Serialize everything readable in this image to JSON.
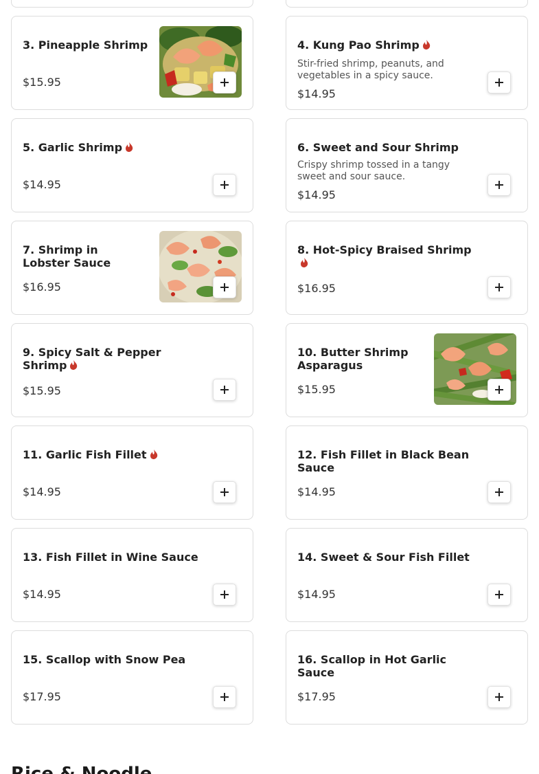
{
  "menu": {
    "items": [
      {
        "name": "3. Pineapple Shrimp",
        "price": "$15.95",
        "spicy": false,
        "image": "food-photo-pineapple-shrimp"
      },
      {
        "name": "4. Kung Pao Shrimp",
        "price": "$14.95",
        "spicy": true,
        "description": "Stir-fried shrimp, peanuts, and vegetables in a spicy sauce."
      },
      {
        "name": "5. Garlic Shrimp",
        "price": "$14.95",
        "spicy": true
      },
      {
        "name": "6. Sweet and Sour Shrimp",
        "price": "$14.95",
        "spicy": false,
        "description": "Crispy shrimp tossed in a tangy sweet and sour sauce."
      },
      {
        "name": "7. Shrimp in Lobster Sauce",
        "price": "$16.95",
        "spicy": false,
        "image": "food-photo-shrimp-lobster-sauce"
      },
      {
        "name": "8. Hot-Spicy Braised Shrimp",
        "price": "$16.95",
        "spicy": true
      },
      {
        "name": "9. Spicy Salt & Pepper Shrimp",
        "price": "$15.95",
        "spicy": true
      },
      {
        "name": "10. Butter Shrimp Asparagus",
        "price": "$15.95",
        "spicy": false,
        "image": "food-photo-butter-shrimp-asparagus"
      },
      {
        "name": "11. Garlic Fish Fillet",
        "price": "$14.95",
        "spicy": true
      },
      {
        "name": "12. Fish Fillet in Black Bean Sauce",
        "price": "$14.95",
        "spicy": false
      },
      {
        "name": "13. Fish Fillet in Wine Sauce",
        "price": "$14.95",
        "spicy": false
      },
      {
        "name": "14. Sweet & Sour Fish Fillet",
        "price": "$14.95",
        "spicy": false
      },
      {
        "name": "15. Scallop with Snow Pea",
        "price": "$17.95",
        "spicy": false
      },
      {
        "name": "16. Scallop in Hot Garlic Sauce",
        "price": "$17.95",
        "spicy": false
      }
    ],
    "spicy_icon": "flame-icon",
    "add_icon": "plus-icon",
    "spicy_color": "#c8382b",
    "next_section_heading": "Rice & Noodle"
  }
}
